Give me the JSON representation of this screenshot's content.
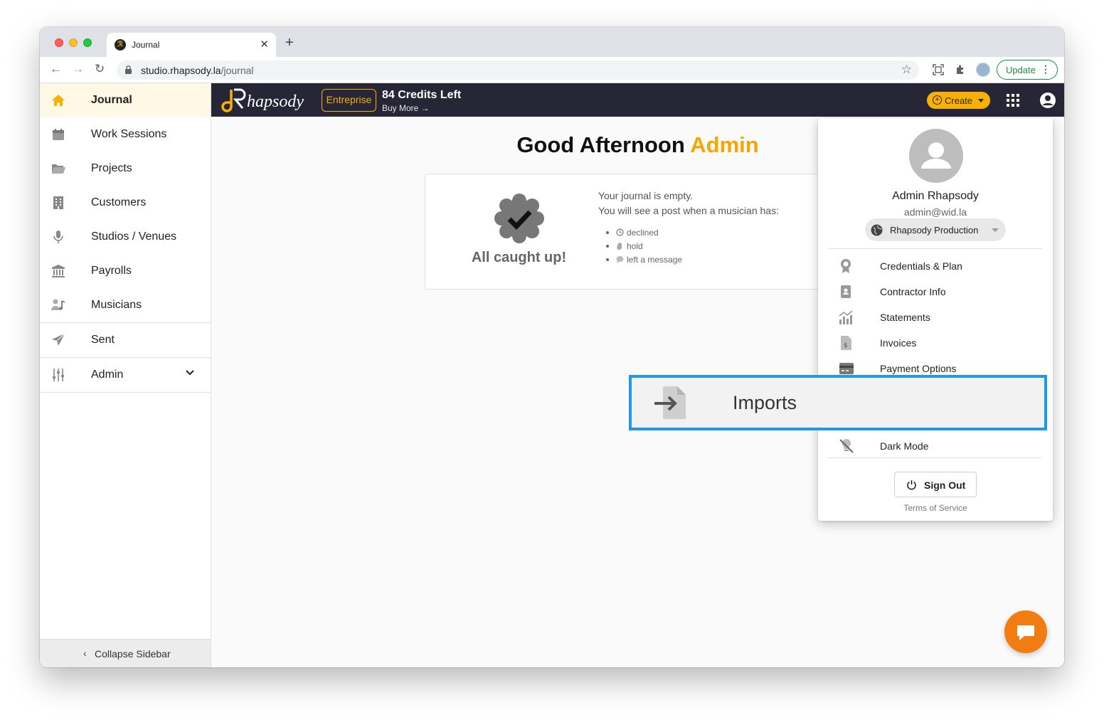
{
  "browser": {
    "tab_title": "Journal",
    "tab_favicon": "rhapsody-favicon-icon",
    "url_host": "studio.rhapsody.la",
    "url_path": "/journal",
    "update_label": "Update",
    "icons": [
      "back-arrow-icon",
      "forward-arrow-icon",
      "reload-icon",
      "lock-icon",
      "star-icon",
      "screen-capture-icon",
      "extensions-icon",
      "more-vert-icon"
    ]
  },
  "sidebar": {
    "items": [
      {
        "label": "Journal",
        "icon": "home-icon",
        "active": true
      },
      {
        "label": "Work Sessions",
        "icon": "calendar-icon"
      },
      {
        "label": "Projects",
        "icon": "folder-open-icon"
      },
      {
        "label": "Customers",
        "icon": "building-icon"
      },
      {
        "label": "Studios / Venues",
        "icon": "microphone-icon"
      },
      {
        "label": "Payrolls",
        "icon": "bank-icon"
      },
      {
        "label": "Musicians",
        "icon": "musician-icon"
      },
      {
        "label": "Sent",
        "icon": "paper-plane-icon"
      },
      {
        "label": "Admin",
        "icon": "sliders-icon"
      }
    ],
    "collapse_label": "Collapse Sidebar"
  },
  "appbar": {
    "plan_badge": "Entreprise",
    "credits": "84 Credits Left",
    "buy_more": "Buy More →",
    "create_label": "Create",
    "accent": "#f9b000",
    "background": "#262637"
  },
  "main": {
    "greeting_prefix": "Good Afternoon",
    "greeting_name": "Admin",
    "journal": {
      "caught_up": "All caught up!",
      "empty_line1": "Your journal is empty.",
      "empty_line2": "You will see a post when a musician has:",
      "reasons": [
        {
          "label": "declined",
          "icon": "clock-icon"
        },
        {
          "label": "hold",
          "icon": "hand-icon"
        },
        {
          "label": "left a message",
          "icon": "chat-bubble-icon"
        }
      ]
    }
  },
  "menu": {
    "name": "Admin Rhapsody",
    "email": "admin@wid.la",
    "organization": "Rhapsody Production",
    "items": [
      {
        "label": "Credentials & Plan",
        "icon": "award-icon"
      },
      {
        "label": "Contractor Info",
        "icon": "id-badge-icon"
      },
      {
        "label": "Statements",
        "icon": "bar-chart-icon"
      },
      {
        "label": "Invoices",
        "icon": "invoice-icon"
      },
      {
        "label": "Payment Options",
        "icon": "credit-card-icon"
      },
      {
        "label": "Dark Mode",
        "icon": "lightbulb-off-icon"
      }
    ],
    "sign_out": "Sign Out",
    "terms": "Terms of Service"
  },
  "highlight": {
    "label": "Imports",
    "icon": "file-import-icon",
    "border_color": "#1f96f0"
  }
}
